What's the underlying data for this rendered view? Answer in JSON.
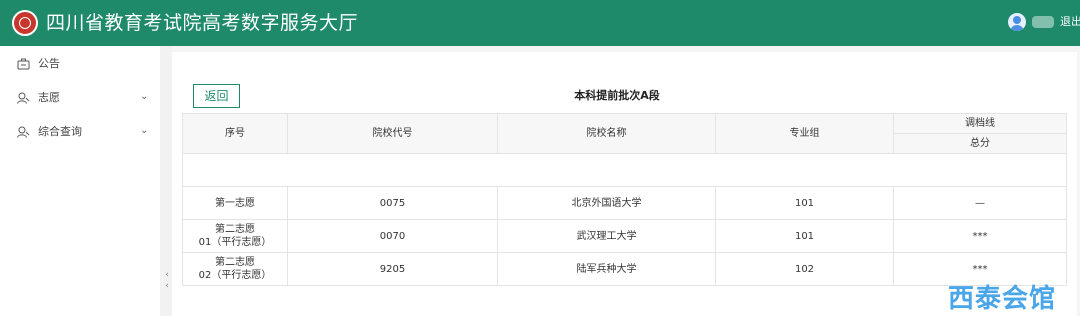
{
  "header": {
    "title": "四川省教育考试院高考数字服务大厅",
    "logout_label": "退出",
    "colors": {
      "primary": "#1e8a6a",
      "logo": "#c8372d"
    }
  },
  "sidebar": {
    "items": [
      {
        "label": "公告",
        "icon": "briefcase-icon",
        "expandable": false
      },
      {
        "label": "志愿",
        "icon": "user-icon",
        "expandable": true
      },
      {
        "label": "综合查询",
        "icon": "user-icon",
        "expandable": true
      }
    ],
    "collapse_glyph": "<\n<"
  },
  "main": {
    "back_label": "返回",
    "table_title": "本科提前批次A段",
    "columns": {
      "seq": "序号",
      "code": "院校代号",
      "name": "院校名称",
      "group": "专业组",
      "adjust_group": "调档线",
      "total": "总分"
    },
    "rows": [
      {
        "seq": "第一志愿",
        "code": "0075",
        "name": "北京外国语大学",
        "group": "101",
        "total": "—"
      },
      {
        "seq": "第二志愿\n01（平行志愿）",
        "code": "0070",
        "name": "武汉理工大学",
        "group": "101",
        "total": "***"
      },
      {
        "seq": "第二志愿\n02（平行志愿）",
        "code": "9205",
        "name": "陆军兵种大学",
        "group": "102",
        "total": "***"
      }
    ]
  },
  "watermark": "西泰会馆"
}
